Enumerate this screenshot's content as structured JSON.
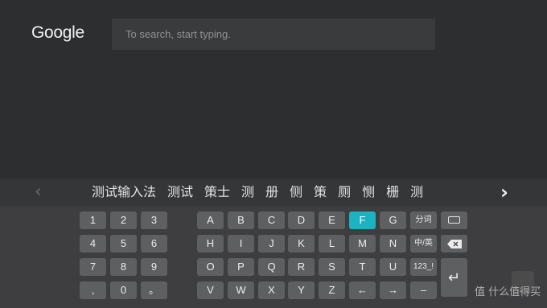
{
  "header": {
    "logo": "Google",
    "search_placeholder": "To search, start typing."
  },
  "candidates": {
    "prev_icon": "chevron-left-icon",
    "next_icon": "chevron-right-icon",
    "items": [
      "测试输入法",
      "测试",
      "策士",
      "测",
      "册",
      "侧",
      "策",
      "厕",
      "恻",
      "栅",
      "测"
    ]
  },
  "keys": {
    "k1": "1",
    "k2": "2",
    "k3": "3",
    "k4": "4",
    "k5": "5",
    "k6": "6",
    "k7": "7",
    "k8": "8",
    "k9": "9",
    "comma": ",",
    "k0": "0",
    "period": "。",
    "A": "A",
    "B": "B",
    "C": "C",
    "D": "D",
    "E": "E",
    "F": "F",
    "G": "G",
    "H": "H",
    "I": "I",
    "J": "J",
    "K": "K",
    "L": "L",
    "M": "M",
    "N": "N",
    "O": "O",
    "P": "P",
    "Q": "Q",
    "R": "R",
    "S": "S",
    "T": "T",
    "U": "U",
    "V": "V",
    "W": "W",
    "X": "X",
    "Y": "Y",
    "Z": "Z",
    "left_arrow": "←",
    "right_arrow": "→",
    "minus": "–",
    "segment": "分词",
    "lang_toggle": "中/英",
    "symbols": "123_!",
    "keyboard_icon": "keyboard-icon",
    "backspace_icon": "backspace-icon",
    "enter": "↵"
  },
  "selected_key": "F",
  "watermark": "值 什么值得买",
  "colors": {
    "accent": "#1bb3bf",
    "background": "#2d2e30",
    "key": "#5e5f61"
  }
}
